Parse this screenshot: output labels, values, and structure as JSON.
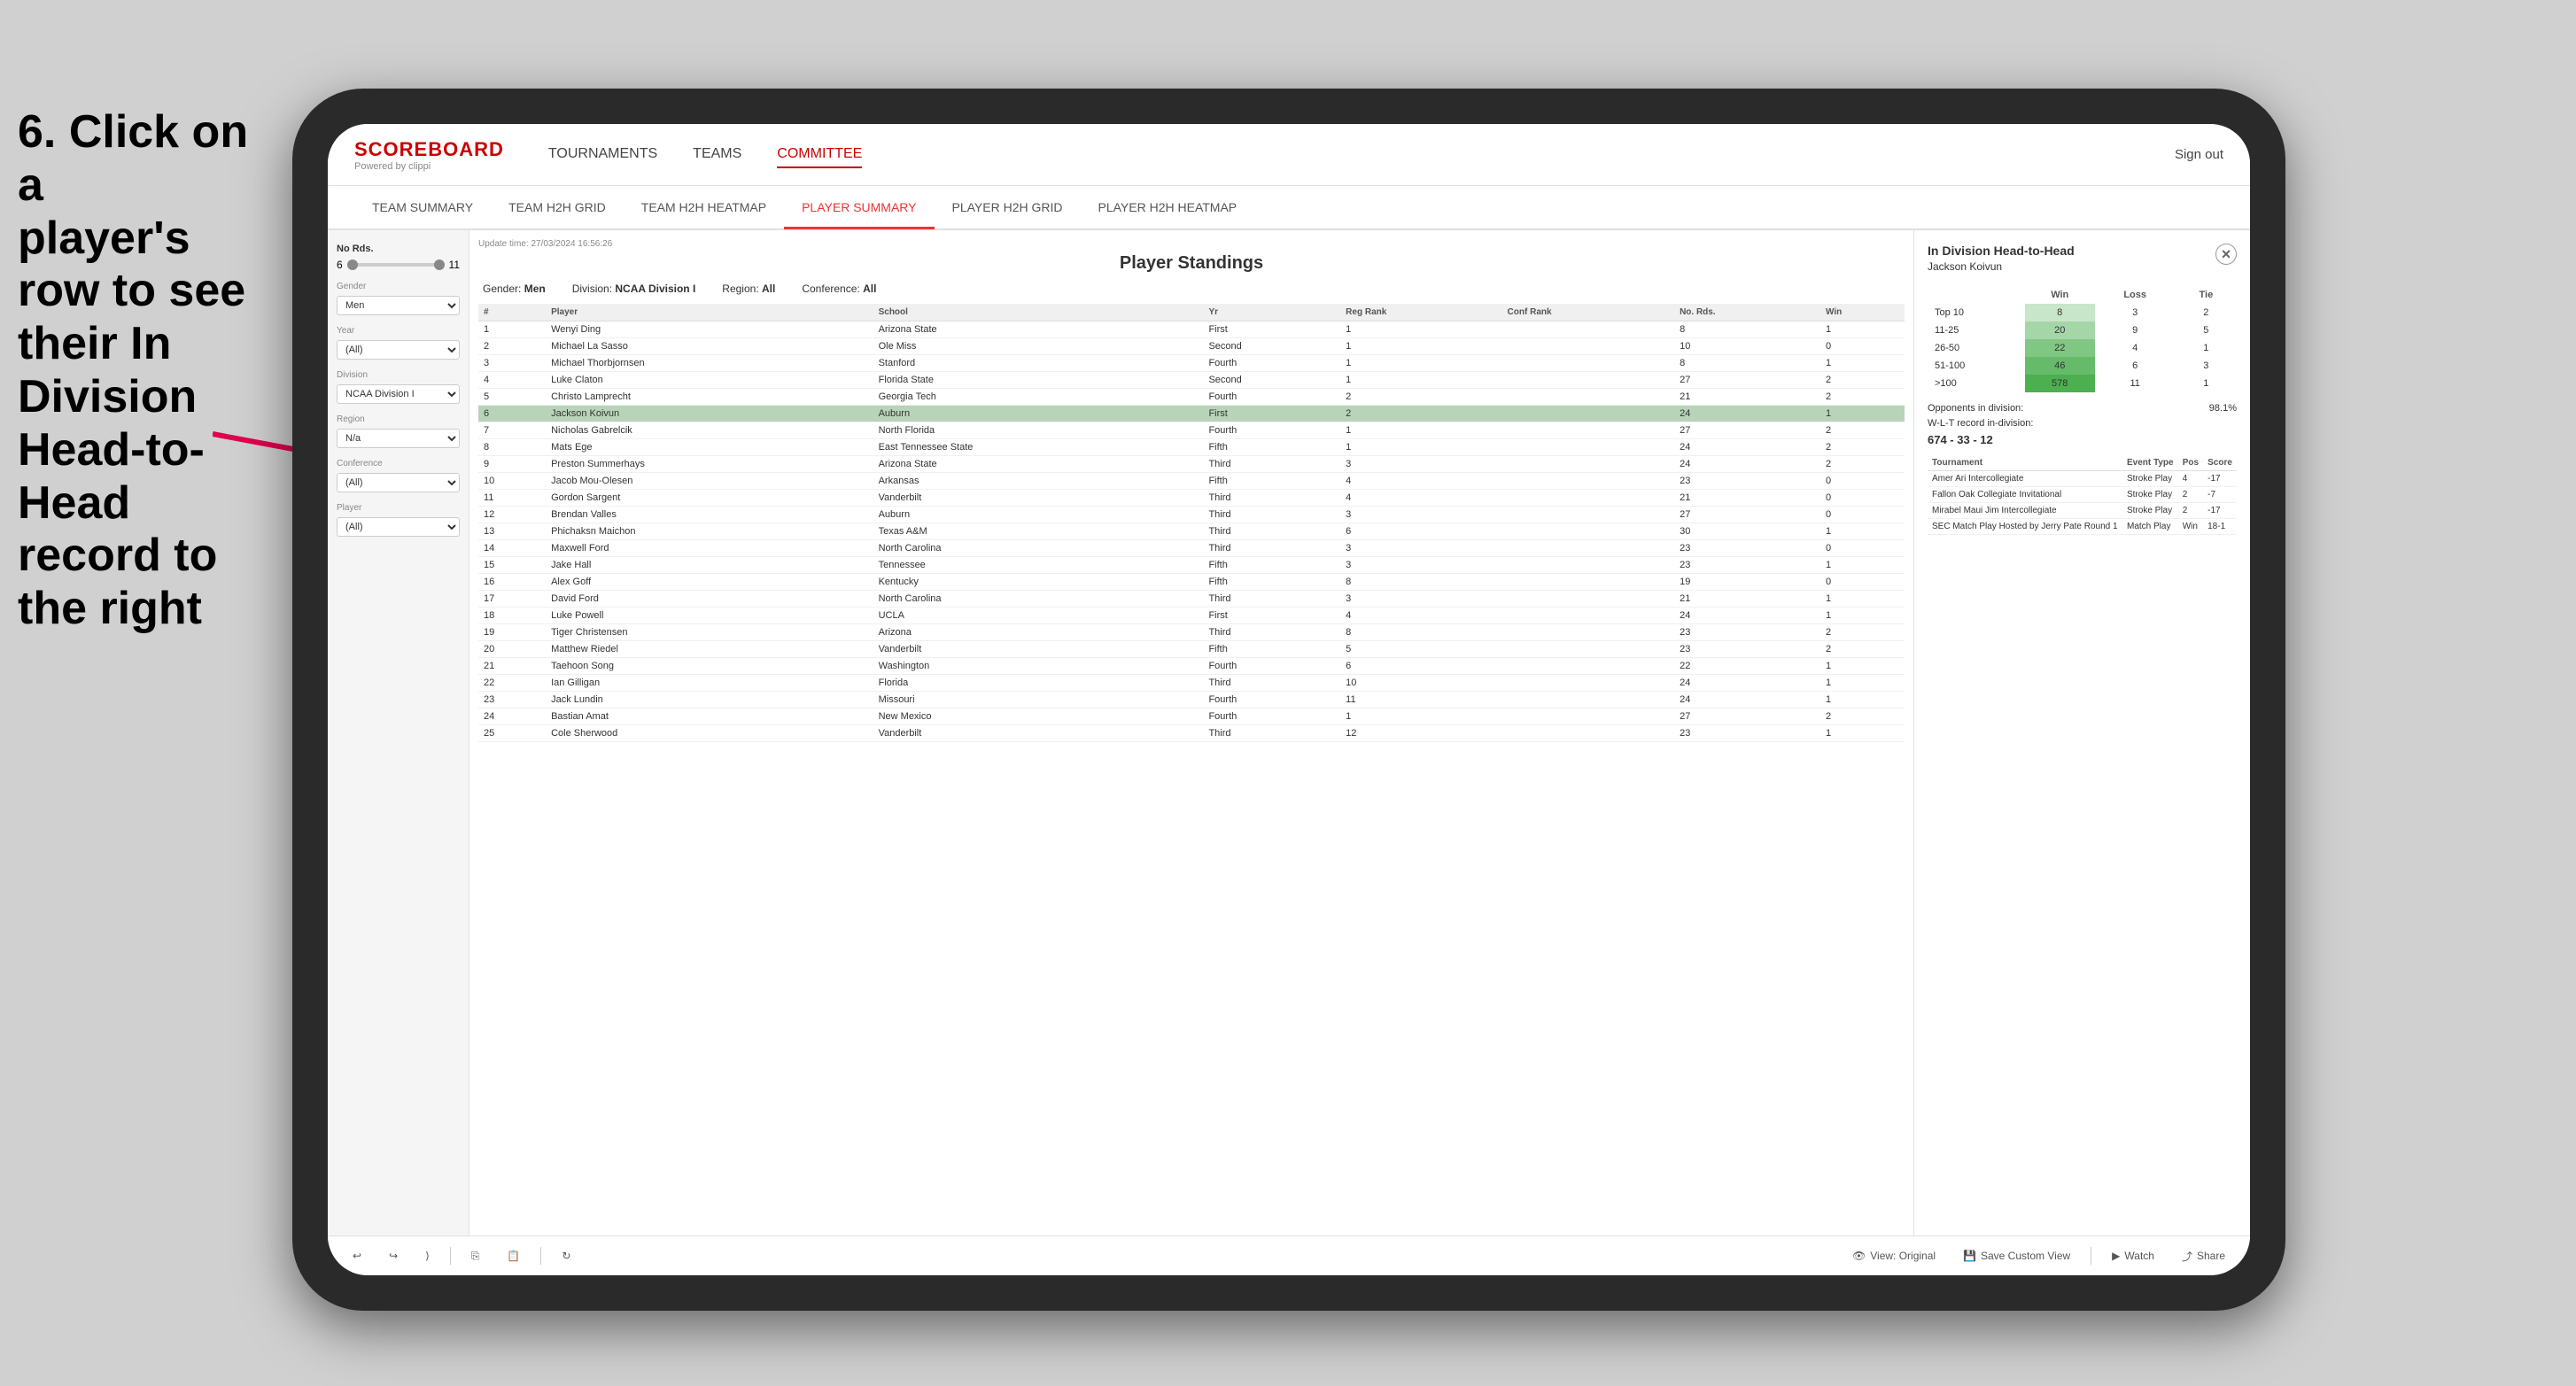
{
  "instruction": {
    "line1": "6. Click on a",
    "line2": "player's row to see",
    "line3": "their In Division",
    "line4": "Head-to-Head",
    "line5": "record to the right"
  },
  "header": {
    "logo": "SCOREBOARD",
    "logo_sub": "Powered by clippi",
    "nav_items": [
      "TOURNAMENTS",
      "TEAMS",
      "COMMITTEE"
    ],
    "sign_out": "Sign out",
    "icon_label": "i"
  },
  "sub_nav": {
    "items": [
      "TEAM SUMMARY",
      "TEAM H2H GRID",
      "TEAM H2H HEATMAP",
      "PLAYER SUMMARY",
      "PLAYER H2H GRID",
      "PLAYER H2H HEATMAP"
    ],
    "active": "PLAYER SUMMARY"
  },
  "sidebar": {
    "no_rds_label": "No Rds.",
    "no_rds_min": "6",
    "no_rds_max": "11",
    "gender_label": "Gender",
    "gender_value": "Men",
    "year_label": "Year",
    "year_value": "(All)",
    "division_label": "Division",
    "division_value": "NCAA Division I",
    "region_label": "Region",
    "region_value": "N/a",
    "conference_label": "Conference",
    "conference_value": "(All)",
    "player_label": "Player",
    "player_value": "(All)"
  },
  "panel": {
    "title": "Player Standings",
    "update_time": "Update time: 27/03/2024 16:56:26",
    "gender": "Men",
    "division": "NCAA Division I",
    "region": "All",
    "conference": "All"
  },
  "table": {
    "headers": [
      "#",
      "Player",
      "School",
      "Yr",
      "Reg Rank",
      "Conf Rank",
      "No. Rds.",
      "Win"
    ],
    "rows": [
      {
        "num": 1,
        "player": "Wenyi Ding",
        "school": "Arizona State",
        "yr": "First",
        "reg_rank": 1,
        "conf_rank": "",
        "no_rds": 8,
        "win": 1
      },
      {
        "num": 2,
        "player": "Michael La Sasso",
        "school": "Ole Miss",
        "yr": "Second",
        "reg_rank": 1,
        "conf_rank": "",
        "no_rds": 10,
        "win": 0
      },
      {
        "num": 3,
        "player": "Michael Thorbjornsen",
        "school": "Stanford",
        "yr": "Fourth",
        "reg_rank": 1,
        "conf_rank": "",
        "no_rds": 8,
        "win": 1
      },
      {
        "num": 4,
        "player": "Luke Claton",
        "school": "Florida State",
        "yr": "Second",
        "reg_rank": 1,
        "conf_rank": "",
        "no_rds": 27,
        "win": 2
      },
      {
        "num": 5,
        "player": "Christo Lamprecht",
        "school": "Georgia Tech",
        "yr": "Fourth",
        "reg_rank": 2,
        "conf_rank": "",
        "no_rds": 21,
        "win": 2
      },
      {
        "num": 6,
        "player": "Jackson Koivun",
        "school": "Auburn",
        "yr": "First",
        "reg_rank": 2,
        "conf_rank": "",
        "no_rds": 24,
        "win": 1,
        "highlighted": true
      },
      {
        "num": 7,
        "player": "Nicholas Gabrelcik",
        "school": "North Florida",
        "yr": "Fourth",
        "reg_rank": 1,
        "conf_rank": "",
        "no_rds": 27,
        "win": 2
      },
      {
        "num": 8,
        "player": "Mats Ege",
        "school": "East Tennessee State",
        "yr": "Fifth",
        "reg_rank": 1,
        "conf_rank": "",
        "no_rds": 24,
        "win": 2
      },
      {
        "num": 9,
        "player": "Preston Summerhays",
        "school": "Arizona State",
        "yr": "Third",
        "reg_rank": 3,
        "conf_rank": "",
        "no_rds": 24,
        "win": 2
      },
      {
        "num": 10,
        "player": "Jacob Mou-Olesen",
        "school": "Arkansas",
        "yr": "Fifth",
        "reg_rank": 4,
        "conf_rank": "",
        "no_rds": 23,
        "win": 0
      },
      {
        "num": 11,
        "player": "Gordon Sargent",
        "school": "Vanderbilt",
        "yr": "Third",
        "reg_rank": 4,
        "conf_rank": "",
        "no_rds": 21,
        "win": 0
      },
      {
        "num": 12,
        "player": "Brendan Valles",
        "school": "Auburn",
        "yr": "Third",
        "reg_rank": 3,
        "conf_rank": "",
        "no_rds": 27,
        "win": 0
      },
      {
        "num": 13,
        "player": "Phichaksn Maichon",
        "school": "Texas A&M",
        "yr": "Third",
        "reg_rank": 6,
        "conf_rank": "",
        "no_rds": 30,
        "win": 1
      },
      {
        "num": 14,
        "player": "Maxwell Ford",
        "school": "North Carolina",
        "yr": "Third",
        "reg_rank": 3,
        "conf_rank": "",
        "no_rds": 23,
        "win": 0
      },
      {
        "num": 15,
        "player": "Jake Hall",
        "school": "Tennessee",
        "yr": "Fifth",
        "reg_rank": 3,
        "conf_rank": "",
        "no_rds": 23,
        "win": 1
      },
      {
        "num": 16,
        "player": "Alex Goff",
        "school": "Kentucky",
        "yr": "Fifth",
        "reg_rank": 8,
        "conf_rank": "",
        "no_rds": 19,
        "win": 0
      },
      {
        "num": 17,
        "player": "David Ford",
        "school": "North Carolina",
        "yr": "Third",
        "reg_rank": 3,
        "conf_rank": "",
        "no_rds": 21,
        "win": 1
      },
      {
        "num": 18,
        "player": "Luke Powell",
        "school": "UCLA",
        "yr": "First",
        "reg_rank": 4,
        "conf_rank": "",
        "no_rds": 24,
        "win": 1
      },
      {
        "num": 19,
        "player": "Tiger Christensen",
        "school": "Arizona",
        "yr": "Third",
        "reg_rank": 8,
        "conf_rank": "",
        "no_rds": 23,
        "win": 2
      },
      {
        "num": 20,
        "player": "Matthew Riedel",
        "school": "Vanderbilt",
        "yr": "Fifth",
        "reg_rank": 5,
        "conf_rank": "",
        "no_rds": 23,
        "win": 2
      },
      {
        "num": 21,
        "player": "Taehoon Song",
        "school": "Washington",
        "yr": "Fourth",
        "reg_rank": 6,
        "conf_rank": "",
        "no_rds": 22,
        "win": 1
      },
      {
        "num": 22,
        "player": "Ian Gilligan",
        "school": "Florida",
        "yr": "Third",
        "reg_rank": 10,
        "conf_rank": "",
        "no_rds": 24,
        "win": 1
      },
      {
        "num": 23,
        "player": "Jack Lundin",
        "school": "Missouri",
        "yr": "Fourth",
        "reg_rank": 11,
        "conf_rank": "",
        "no_rds": 24,
        "win": 1
      },
      {
        "num": 24,
        "player": "Bastian Amat",
        "school": "New Mexico",
        "yr": "Fourth",
        "reg_rank": 1,
        "conf_rank": "",
        "no_rds": 27,
        "win": 2
      },
      {
        "num": 25,
        "player": "Cole Sherwood",
        "school": "Vanderbilt",
        "yr": "Third",
        "reg_rank": 12,
        "conf_rank": "",
        "no_rds": 23,
        "win": 1
      }
    ]
  },
  "h2h": {
    "title": "In Division Head-to-Head",
    "player": "Jackson Koivun",
    "close_label": "×",
    "headers": [
      "",
      "Win",
      "Loss",
      "Tie"
    ],
    "rows": [
      {
        "rank": "Top 10",
        "win": 8,
        "loss": 3,
        "tie": 2
      },
      {
        "rank": "11-25",
        "win": 20,
        "loss": 9,
        "tie": 5
      },
      {
        "rank": "26-50",
        "win": 22,
        "loss": 4,
        "tie": 1
      },
      {
        "rank": "51-100",
        "win": 46,
        "loss": 6,
        "tie": 3
      },
      {
        "rank": ">100",
        "win": 578,
        "loss": 11,
        "tie": 1
      }
    ],
    "opponents_label": "Opponents in division:",
    "wlt_label": "W-L-T record in-division:",
    "opponents_pct": "98.1%",
    "wlt_record": "674 - 33 - 12",
    "tournament_headers": [
      "Tournament",
      "Event Type",
      "Pos",
      "Score"
    ],
    "tournaments": [
      {
        "name": "Amer Ari Intercollegiate",
        "type": "Stroke Play",
        "pos": 4,
        "score": "-17"
      },
      {
        "name": "Fallon Oak Collegiate Invitational",
        "type": "Stroke Play",
        "pos": 2,
        "score": "-7"
      },
      {
        "name": "Mirabel Maui Jim Intercollegiate",
        "type": "Stroke Play",
        "pos": 2,
        "score": "-17"
      },
      {
        "name": "SEC Match Play Hosted by Jerry Pate Round 1",
        "type": "Match Play",
        "pos": "Win",
        "score": "18-1"
      }
    ]
  },
  "toolbar": {
    "view_original": "View: Original",
    "save_custom": "Save Custom View",
    "watch": "Watch",
    "share": "Share"
  }
}
